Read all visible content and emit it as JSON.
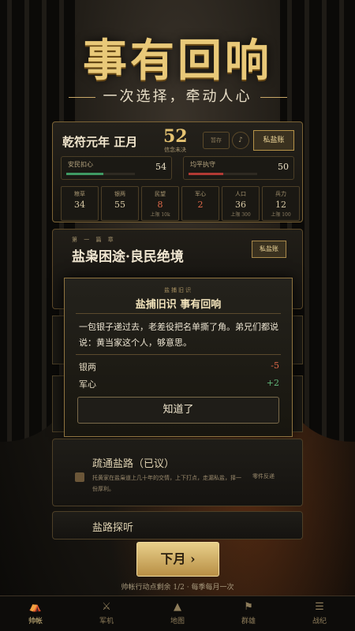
{
  "hero": {
    "title": "事有回响",
    "subtitle": "一次选择，牵动人心"
  },
  "status": {
    "date": "乾符元年 正月",
    "big_number": "52",
    "big_number_label": "信念未决",
    "pause_label": "暂存",
    "sound_icon": "speaker-icon",
    "ledger_label": "私盐账",
    "meters": [
      {
        "label": "安民扣心",
        "value": "54",
        "fill_pct": 54,
        "color": "#3f9a64"
      },
      {
        "label": "均平执守",
        "value": "50",
        "fill_pct": 50,
        "color": "#b23a34"
      }
    ],
    "stats": [
      {
        "label": "粮草",
        "value": "34",
        "cap": ""
      },
      {
        "label": "银两",
        "value": "55",
        "cap": ""
      },
      {
        "label": "民望",
        "value": "8",
        "cap": "上限 10k"
      },
      {
        "label": "军心",
        "value": "2",
        "cap": ""
      },
      {
        "label": "人口",
        "value": "36",
        "cap": "上限 300"
      },
      {
        "label": "兵力",
        "value": "12",
        "cap": "上限 100"
      }
    ]
  },
  "chapter": {
    "small": "第 一 篇 章",
    "title": "盐枭困途·良民绝境",
    "button": "私盐账"
  },
  "modal": {
    "small": "盐捕旧识",
    "title": "盐捕旧识  事有回响",
    "body": "一包银子递过去，老差役把名单撕了角。弟兄们都说说：黄当家这个人，够意思。",
    "effects": [
      {
        "label": "银两",
        "value": "-5",
        "color": "#e06a4a"
      },
      {
        "label": "军心",
        "value": "+2",
        "color": "#63b77b"
      }
    ],
    "confirm": "知道了"
  },
  "cards": [
    {
      "title": "疏通盐路（已议）",
      "desc": "托黄家在盐枭道上几十年的交情，上下打点，走漏私盐，择一份厚利。",
      "tag": "零件反递"
    },
    {
      "title": "盐路探听"
    }
  ],
  "footer": {
    "next": "下月 ›",
    "hint": "帅帐行动点剩余 1/2 · 每季每月一次"
  },
  "nav": [
    {
      "label": "帅帐",
      "icon": "tent-icon"
    },
    {
      "label": "军机",
      "icon": "sword-icon"
    },
    {
      "label": "地图",
      "icon": "mountain-icon"
    },
    {
      "label": "群雄",
      "icon": "flag-icon"
    },
    {
      "label": "战纪",
      "icon": "scroll-icon"
    }
  ]
}
